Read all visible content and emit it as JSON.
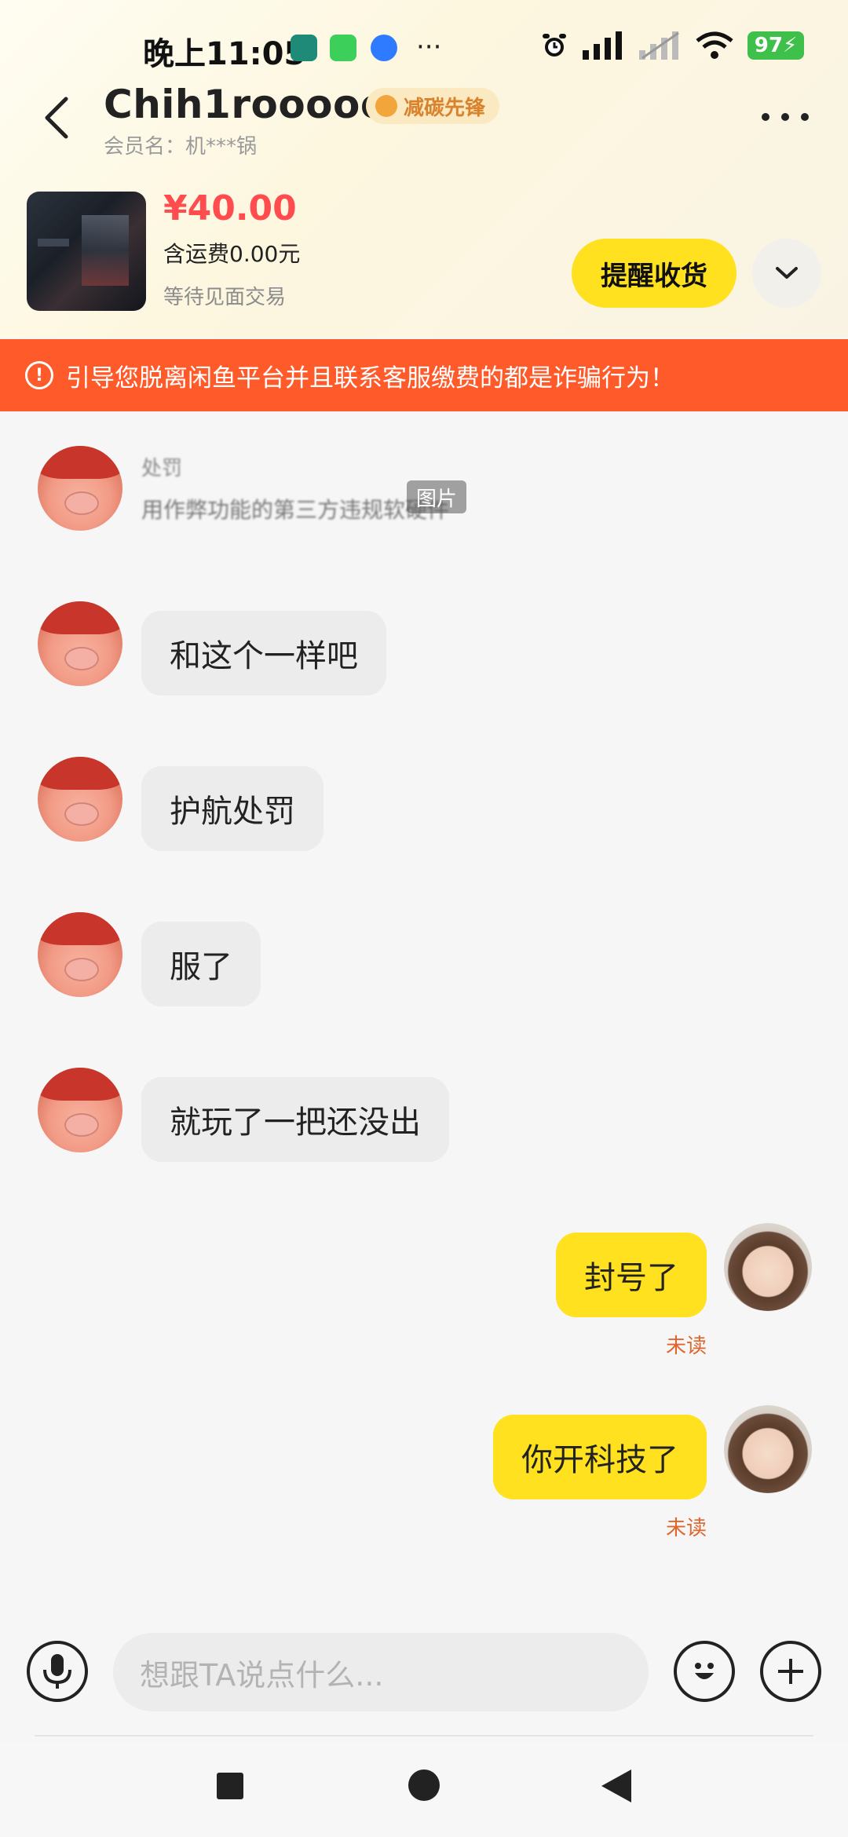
{
  "status_bar": {
    "time": "晚上11:05",
    "icons": [
      "screen-cast-icon",
      "shield-icon",
      "notification-icon",
      "more-dots-icon",
      "alarm-icon",
      "signal-icon",
      "signal-off-icon",
      "wifi-icon"
    ],
    "battery": "97"
  },
  "header": {
    "title": "Chih1rooooooo",
    "badge": "减碳先锋",
    "member": "会员名：机***锅"
  },
  "product": {
    "price": "¥40.00",
    "shipping": "含运费0.00元",
    "status": "等待见面交易",
    "remind_button": "提醒收货"
  },
  "warning": {
    "text": "引导您脱离闲鱼平台并且联系客服缴费的都是诈骗行为！",
    "color": "#ff5a2a"
  },
  "messages": {
    "image_msg": {
      "small_text": "处罚",
      "line": "用作弊功能的第三方违规软硬件",
      "tag": "图片"
    },
    "incoming": [
      "和这个一样吧",
      "护航处罚",
      "服了",
      "就玩了一把还没出"
    ],
    "outgoing": [
      {
        "text": "封号了",
        "status": "未读"
      },
      {
        "text": "你开科技了",
        "status": "未读"
      }
    ]
  },
  "input": {
    "placeholder": "想跟TA说点什么..."
  },
  "colors": {
    "accent_yellow": "#ffe11f",
    "price_red": "#ff4d4f",
    "unread_orange": "#e0652d"
  }
}
